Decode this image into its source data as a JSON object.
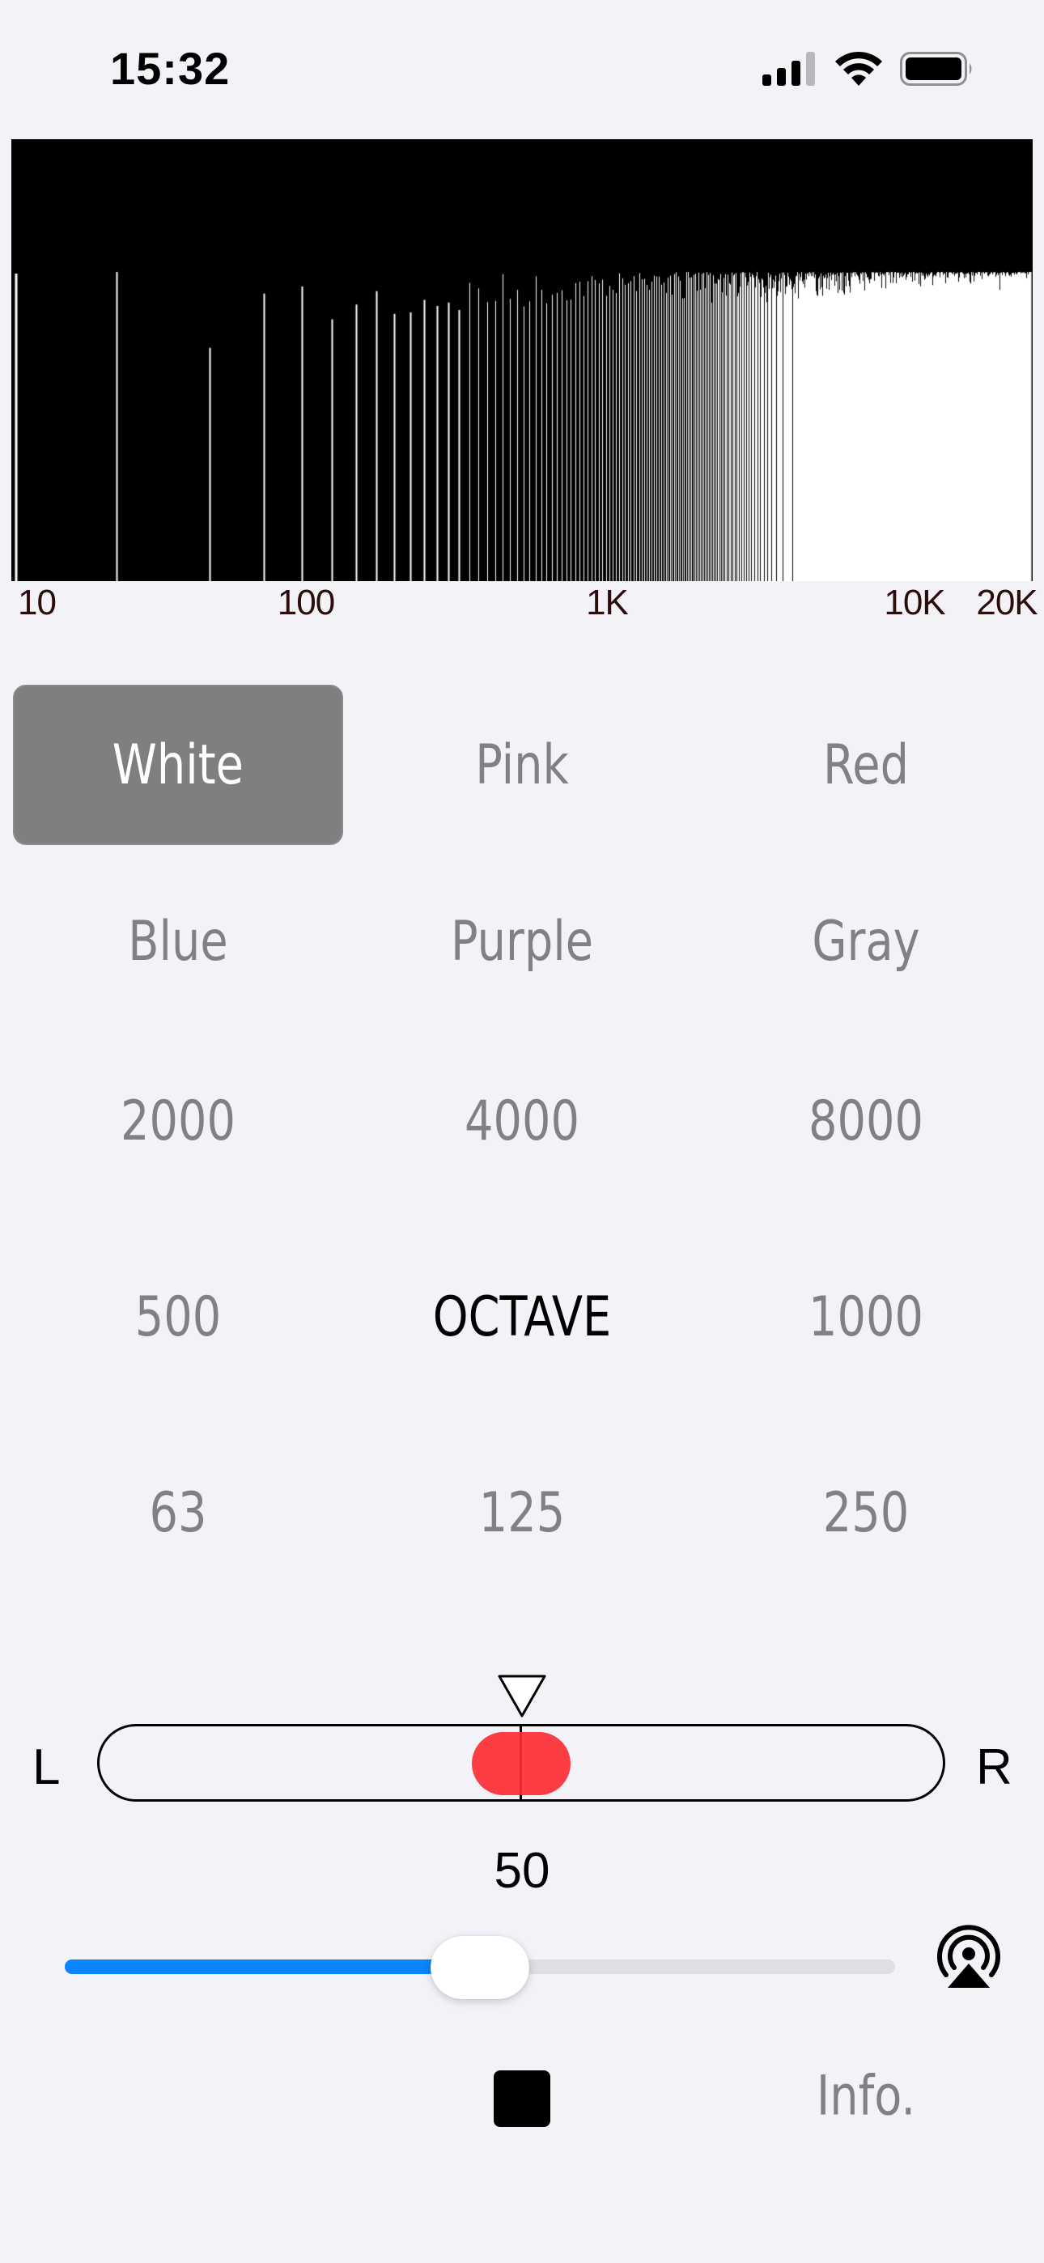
{
  "status_bar": {
    "time": "15:32",
    "icons": [
      "cellular-signal-icon",
      "wifi-icon",
      "battery-icon"
    ]
  },
  "spectrum": {
    "axis_labels": [
      "10",
      "100",
      "1K",
      "10K",
      "20K"
    ]
  },
  "noise_types": [
    {
      "label": "White",
      "selected": true
    },
    {
      "label": "Pink",
      "selected": false
    },
    {
      "label": "Red",
      "selected": false
    },
    {
      "label": "Blue",
      "selected": false
    },
    {
      "label": "Purple",
      "selected": false
    },
    {
      "label": "Gray",
      "selected": false
    }
  ],
  "bands": {
    "row1": [
      "2000",
      "4000",
      "8000"
    ],
    "row2": [
      "500",
      "OCTAVE",
      "1000"
    ],
    "row3": [
      "63",
      "125",
      "250"
    ]
  },
  "balance": {
    "left_label": "L",
    "right_label": "R",
    "position": 0.5
  },
  "volume": {
    "value": "50",
    "level": 0.5
  },
  "controls": {
    "stop_icon": "stop-icon",
    "info_label": "Info.",
    "airplay_icon": "airplay-icon"
  },
  "colors": {
    "accent": "#0a84ff",
    "balance_knob": "#fc3d44",
    "selected_bg": "#7f7f7f"
  }
}
